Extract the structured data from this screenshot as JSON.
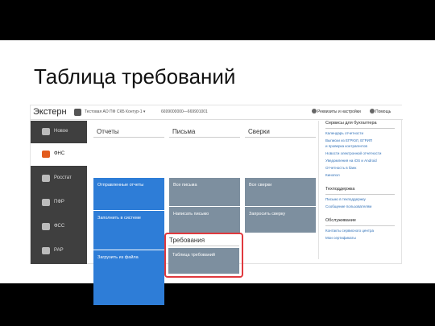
{
  "slide": {
    "title": "Таблица требований"
  },
  "app": {
    "brand": "Экстерн",
    "org": "Тестовая АО ПФ СКБ Контур-1 ▾",
    "inn": "6699000000—669901001",
    "requisites": "Реквизиты и настройки",
    "help": "Помощь"
  },
  "sidebar": {
    "items": [
      {
        "label": "Новое",
        "icon": "new-icon"
      },
      {
        "label": "ФНС",
        "icon": "fns-icon",
        "active": true
      },
      {
        "label": "Росстат",
        "icon": "rosstat-icon"
      },
      {
        "label": "ПФР",
        "icon": "pfr-icon"
      },
      {
        "label": "ФСС",
        "icon": "fss-icon"
      },
      {
        "label": "РАР",
        "icon": "rar-icon"
      }
    ]
  },
  "sections": {
    "reports": {
      "title": "Отчеты",
      "tiles": [
        "Отправленные отчеты",
        "Заполнить в системе",
        "Загрузить из файла"
      ]
    },
    "letters": {
      "title": "Письма",
      "tiles": [
        "Все письма",
        "Написать письмо"
      ]
    },
    "reconciliations": {
      "title": "Сверки",
      "tiles": [
        "Все сверки",
        "Запросить сверку"
      ]
    },
    "requirements": {
      "title": "Требования",
      "tiles": [
        "Таблица требований"
      ]
    }
  },
  "right_panel": {
    "services_title": "Сервисы для бухгалтера",
    "services": [
      "Календарь отчетности",
      "Выписки из ЕГРЮЛ, ЕГРИП",
      "и проверка контрагентов",
      "Новости электронной отчетности",
      "Уведомления на iOS и Android",
      "Отчетность в банк",
      "Кинопол"
    ],
    "support_title": "Техподдержка",
    "support": [
      "Письмо в техподдержку",
      "Сообщение пользователям"
    ],
    "service_title": "Обслуживание",
    "service": [
      "Контакты сервисного центра",
      "Мои сертификаты"
    ]
  },
  "colors": {
    "blue_tile": "#2e7dd7",
    "gray_tile": "#7d8f9f",
    "sidebar": "#3f3f3f",
    "highlight": "#e0393e",
    "accent": "#e25c1e"
  }
}
